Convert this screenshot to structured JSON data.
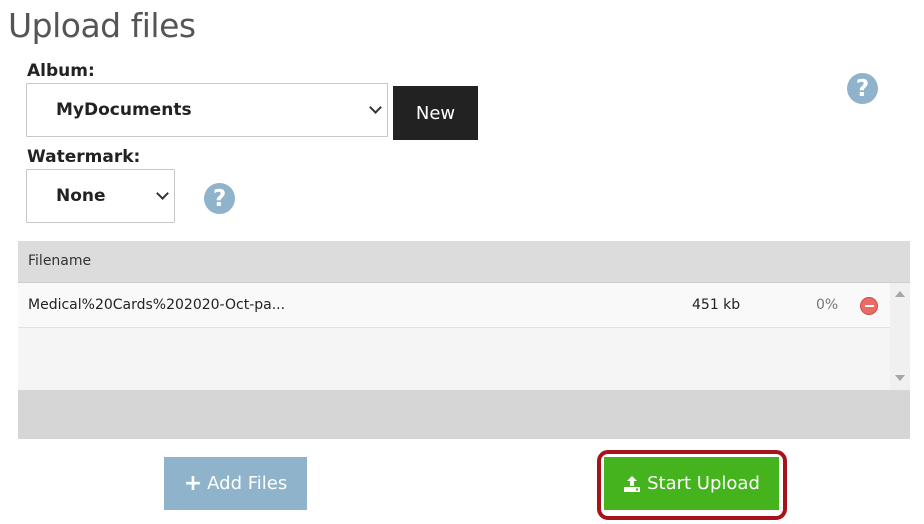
{
  "page": {
    "title": "Upload files"
  },
  "album": {
    "label": "Album:",
    "selected": "MyDocuments",
    "new_button_label": "New"
  },
  "watermark": {
    "label": "Watermark:",
    "selected": "None"
  },
  "help": {
    "glyph": "?",
    "icon": "question-circle-icon"
  },
  "file_table": {
    "header": "Filename",
    "rows": [
      {
        "filename": "Medical%20Cards%202020-Oct-pa...",
        "size": "451 kb",
        "progress": "0%",
        "progress_value": 0
      }
    ]
  },
  "actions": {
    "add_files_label": "Add Files",
    "start_upload_label": "Start Upload"
  },
  "colors": {
    "dark_button": "#222222",
    "info_blue": "#8fb3cb",
    "upload_green": "#44b31d",
    "highlight_red": "#a8131b",
    "remove_red": "#ea6b63"
  }
}
